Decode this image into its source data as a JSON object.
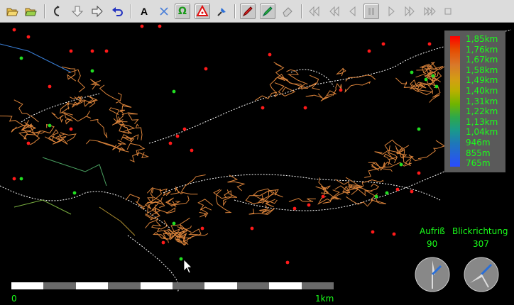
{
  "toolbar": {
    "buttons": [
      {
        "name": "open-folder-button",
        "icon": "folder-open-icon"
      },
      {
        "name": "open-folder-green-button",
        "icon": "folder-open-green-icon"
      },
      {
        "name": "rotate-left-button",
        "icon": "rotate-left-icon"
      },
      {
        "name": "arrow-down-button",
        "icon": "arrow-down-icon"
      },
      {
        "name": "arrow-right-button",
        "icon": "arrow-right-icon"
      },
      {
        "name": "undo-button",
        "icon": "undo-icon"
      },
      {
        "name": "text-label-button",
        "icon": "text-a-icon",
        "text": "A"
      },
      {
        "name": "close-x-button",
        "icon": "x-icon"
      },
      {
        "name": "omega-button",
        "icon": "omega-icon",
        "text": "Ω"
      },
      {
        "name": "warning-button",
        "icon": "warning-triangle-icon"
      },
      {
        "name": "pin-button",
        "icon": "pin-icon"
      },
      {
        "name": "pen-red-button",
        "icon": "pen-red-icon"
      },
      {
        "name": "pen-green-button",
        "icon": "pen-green-icon"
      },
      {
        "name": "eraser-button",
        "icon": "eraser-icon"
      },
      {
        "name": "skip-back-fast-button",
        "icon": "double-chevron-left-icon"
      },
      {
        "name": "skip-back-button",
        "icon": "double-chevron-left-icon"
      },
      {
        "name": "step-back-button",
        "icon": "chevron-left-icon"
      },
      {
        "name": "pause-button",
        "icon": "pause-icon"
      },
      {
        "name": "step-forward-button",
        "icon": "chevron-right-icon"
      },
      {
        "name": "skip-forward-button",
        "icon": "double-chevron-right-icon"
      },
      {
        "name": "skip-forward-fast-button",
        "icon": "triple-chevron-right-icon"
      },
      {
        "name": "stop-button",
        "icon": "stop-icon"
      }
    ]
  },
  "legend": {
    "labels": [
      "1,85km",
      "1,76km",
      "1,67km",
      "1,58km",
      "1,49km",
      "1,40km",
      "1,31km",
      "1,22km",
      "1,13km",
      "1,04km",
      "946m",
      "855m",
      "765m"
    ],
    "top_color": "#ff0000",
    "bottom_color": "#2a4cff"
  },
  "view": {
    "aufriss_label": "Aufriß",
    "aufriss_value": "90",
    "blickrichtung_label": "Blickrichtung",
    "blickrichtung_value": "307"
  },
  "scale": {
    "start_label": "0",
    "end_label": "1km",
    "segments": 10
  },
  "colors": {
    "background": "#000000",
    "dots_red": "#ff1a1a",
    "dots_green": "#22dd22",
    "survey_line": "#d9823a",
    "label_green": "#1aff1a"
  }
}
